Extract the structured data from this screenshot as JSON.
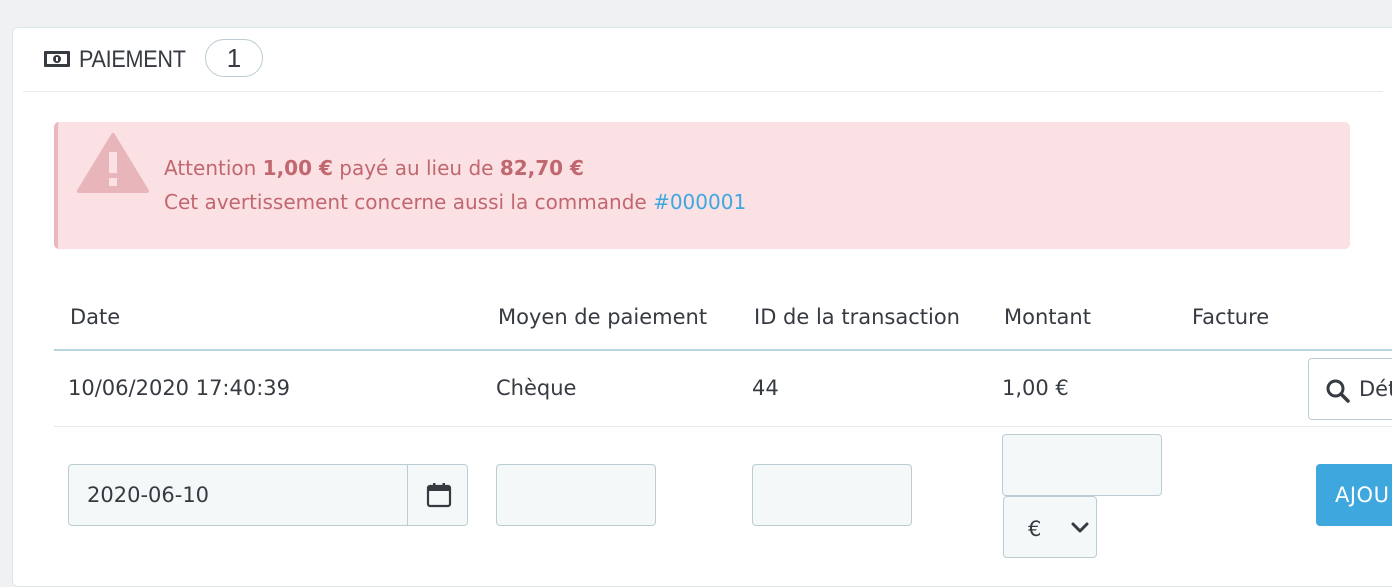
{
  "panel": {
    "title": "PAIEMENT",
    "count": "1",
    "icon": "money-icon"
  },
  "alert": {
    "icon": "warning-icon",
    "prefix": "Attention",
    "paid": "1,00 €",
    "middle": "payé au lieu de",
    "expected": "82,70 €",
    "line2_text": "Cet avertissement concerne aussi la commande",
    "order_ref": "#000001",
    "color": "#c0676f",
    "background": "#fbe1e4"
  },
  "table": {
    "headers": {
      "date": "Date",
      "method": "Moyen de paiement",
      "transaction": "ID de la transaction",
      "amount": "Montant",
      "invoice": "Facture"
    },
    "rows": [
      {
        "date": "10/06/2020 17:40:39",
        "method": "Chèque",
        "transaction": "44",
        "amount": "1,00 €",
        "invoice": "",
        "details_label": "Dét"
      }
    ]
  },
  "form": {
    "date_value": "2020-06-10",
    "method_value": "",
    "transaction_value": "",
    "amount_value": "",
    "currency_selected": "€",
    "add_label": "AJOU",
    "accent": "#3ea8de"
  }
}
